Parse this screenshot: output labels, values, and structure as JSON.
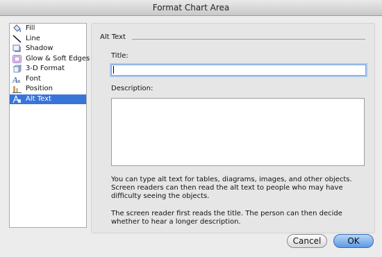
{
  "window": {
    "title": "Format Chart Area"
  },
  "sidebar": {
    "items": [
      {
        "label": "Fill",
        "icon": "fill-bucket-icon"
      },
      {
        "label": "Line",
        "icon": "line-icon"
      },
      {
        "label": "Shadow",
        "icon": "shadow-icon"
      },
      {
        "label": "Glow & Soft Edges",
        "icon": "glow-icon"
      },
      {
        "label": "3-D Format",
        "icon": "3d-format-icon"
      },
      {
        "label": "Font",
        "icon": "font-icon"
      },
      {
        "label": "Position",
        "icon": "position-icon"
      },
      {
        "label": "Alt Text",
        "icon": "alt-text-icon",
        "selected": true
      }
    ]
  },
  "panel": {
    "section_title": "Alt Text",
    "title_label": "Title:",
    "title_value": "",
    "description_label": "Description:",
    "description_value": "",
    "info_1": "You can type alt text for tables, diagrams, images, and other objects. Screen readers can then read the alt text to people who may have difficulty seeing the objects.",
    "info_2": "The screen reader first reads the title. The person can then decide whether to hear a longer description."
  },
  "buttons": {
    "cancel": "Cancel",
    "ok": "OK"
  },
  "colors": {
    "selection": "#3875d7",
    "focus_ring": "#a9c7ef"
  }
}
